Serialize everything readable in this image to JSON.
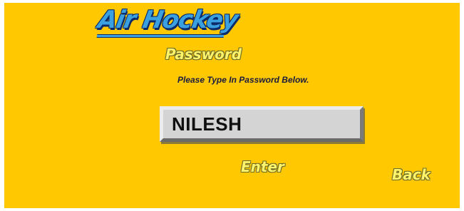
{
  "logo": {
    "text": "Air Hockey"
  },
  "screen": {
    "heading": "Password",
    "instruction": "Please Type In Password Below."
  },
  "password_field": {
    "value": "NILESH"
  },
  "buttons": {
    "enter_label": "Enter",
    "back_label": "Back"
  },
  "colors": {
    "background": "#ffc800",
    "logo": "#3aa0e0",
    "button_text": "#fff46a",
    "field": "#d4d4d4"
  }
}
